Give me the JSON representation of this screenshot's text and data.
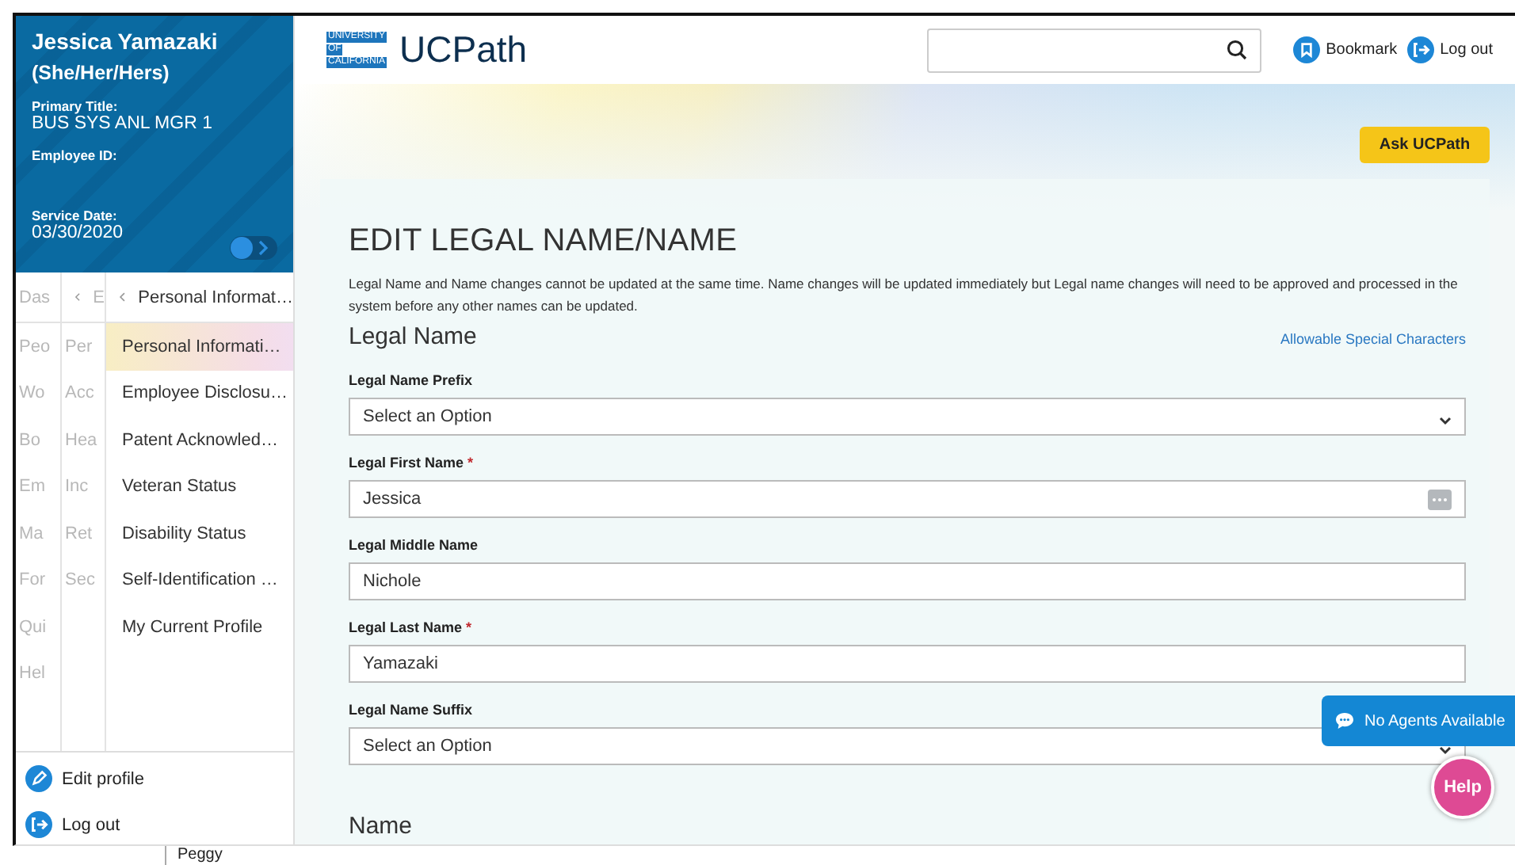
{
  "profile": {
    "name": "Jessica Yamazaki",
    "pronouns": "(She/Her/Hers)",
    "fields": [
      {
        "label": "Primary Title:",
        "value": "BUS SYS ANL MGR 1"
      },
      {
        "label": "Employee ID:"
      },
      {
        "label": "Service Date:",
        "value": "03/30/2020"
      }
    ]
  },
  "nav": {
    "column_1": {
      "items": [
        "Das",
        "Peo",
        "Wo",
        "Bo",
        "Em",
        "Ma",
        "For",
        "Qui",
        "Hel"
      ]
    },
    "column_2": {
      "header": "E",
      "items": [
        "Per",
        "Acc",
        "Hea",
        "Inc",
        "Ret",
        "Sec"
      ]
    },
    "column_3": {
      "header": "Personal Informat…",
      "items": [
        {
          "label": "Personal Informati…",
          "selected": true
        },
        {
          "label": "Employee Disclosu…",
          "selected": false
        },
        {
          "label": "Patent Acknowled…",
          "selected": false
        },
        {
          "label": "Veteran Status",
          "selected": false
        },
        {
          "label": "Disability Status",
          "selected": false
        },
        {
          "label": "Self-Identification …",
          "selected": false
        },
        {
          "label": "My Current Profile",
          "selected": false
        }
      ]
    }
  },
  "sidebar_actions": [
    {
      "label": "Edit profile",
      "kind": "edit"
    },
    {
      "label": "Log out",
      "kind": "logout"
    }
  ],
  "footer_fragment": "Peggy",
  "header": {
    "logo_mark": [
      "UNIVERSITY",
      "OF",
      "CALIFORNIA"
    ],
    "logo": "UCPath",
    "actions": [
      {
        "label": "Bookmark",
        "kind": "bookmark"
      },
      {
        "label": "Log out",
        "kind": "logout"
      }
    ]
  },
  "ask_button": "Ask UCPath",
  "form": {
    "title": "EDIT LEGAL NAME/NAME",
    "description": "Legal Name and Name changes cannot be updated at the same time. Name changes will be updated immediately but Legal name changes will need to be approved and processed in the system before any other names can be updated.",
    "section": "Legal Name",
    "link": "Allowable Special Characters",
    "required_mark": "*",
    "fields": [
      {
        "label": "Legal Name Prefix",
        "kind": "select",
        "value": "Select an Option",
        "required": false
      },
      {
        "label": "Legal First Name",
        "kind": "text_menu",
        "value": "Jessica",
        "required": true
      },
      {
        "label": "Legal Middle Name",
        "kind": "text",
        "value": "Nichole",
        "required": false
      },
      {
        "label": "Legal Last Name",
        "kind": "text",
        "value": "Yamazaki",
        "required": true
      },
      {
        "label": "Legal Name Suffix",
        "kind": "select",
        "value": "Select an Option",
        "required": false
      }
    ],
    "next_section": "Name"
  },
  "chat": "No Agents Available",
  "help": "Help"
}
